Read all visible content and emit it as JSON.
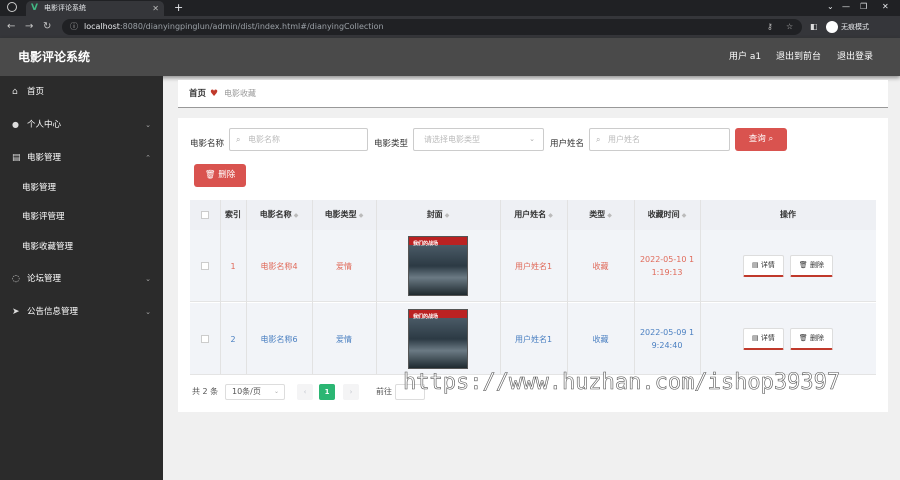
{
  "browser": {
    "tab_title": "电影评论系统",
    "tab_close": "✕",
    "new_tab": "+",
    "url_host": "localhost",
    "url_rest": ":8080/dianyingpinglun/admin/dist/index.html#/dianyingCollection",
    "profile_label": "无痕模式",
    "win_min": "—",
    "win_max": "❐",
    "win_close": "✕",
    "win_menu": "⌄"
  },
  "header": {
    "brand": "电影评论系统",
    "user": "用户 a1",
    "back_front": "退出到前台",
    "logout": "退出登录"
  },
  "sidebar": {
    "items": [
      {
        "label": "首页",
        "icon": "⌂"
      },
      {
        "label": "个人中心",
        "icon": "👤"
      },
      {
        "label": "电影管理",
        "icon": "▤"
      },
      {
        "label": "电影管理"
      },
      {
        "label": "电影评管理"
      },
      {
        "label": "电影收藏管理"
      },
      {
        "label": "论坛管理",
        "icon": "◌"
      },
      {
        "label": "公告信息管理",
        "icon": "➤"
      }
    ]
  },
  "breadcrumb": {
    "home": "首页",
    "current": "电影收藏"
  },
  "search": {
    "name_label": "电影名称",
    "name_placeholder": "电影名称",
    "type_label": "电影类型",
    "type_placeholder": "请选择电影类型",
    "user_label": "用户姓名",
    "user_placeholder": "用户姓名",
    "query_button": "查询",
    "delete_button": "删除"
  },
  "table": {
    "headers": {
      "index": "索引",
      "name": "电影名称",
      "type": "电影类型",
      "cover": "封面",
      "user": "用户姓名",
      "kind": "类型",
      "time": "收藏时间",
      "ops": "操作"
    },
    "rows": [
      {
        "index": "1",
        "name": "电影名称4",
        "type": "爱情",
        "user": "用户姓名1",
        "kind": "收藏",
        "time1": "2022-05-10 1",
        "time2": "1:19:13"
      },
      {
        "index": "2",
        "name": "电影名称6",
        "type": "爱情",
        "user": "用户姓名1",
        "kind": "收藏",
        "time1": "2022-05-09 1",
        "time2": "9:24:40"
      }
    ],
    "detail_label": "详情",
    "delete_label": "删除",
    "poster_text": "我们的战场"
  },
  "pager": {
    "total": "共 2 条",
    "size": "10条/页",
    "prev": "‹",
    "page": "1",
    "next": "›",
    "goto": "前往"
  },
  "watermark": "https://www.huzhan.com/ishop39397",
  "colors": {
    "row1_text": "#e06a5a",
    "row2_text": "#4a7fc1",
    "accent_red": "#d9534f",
    "pager_active": "#2bb673"
  }
}
